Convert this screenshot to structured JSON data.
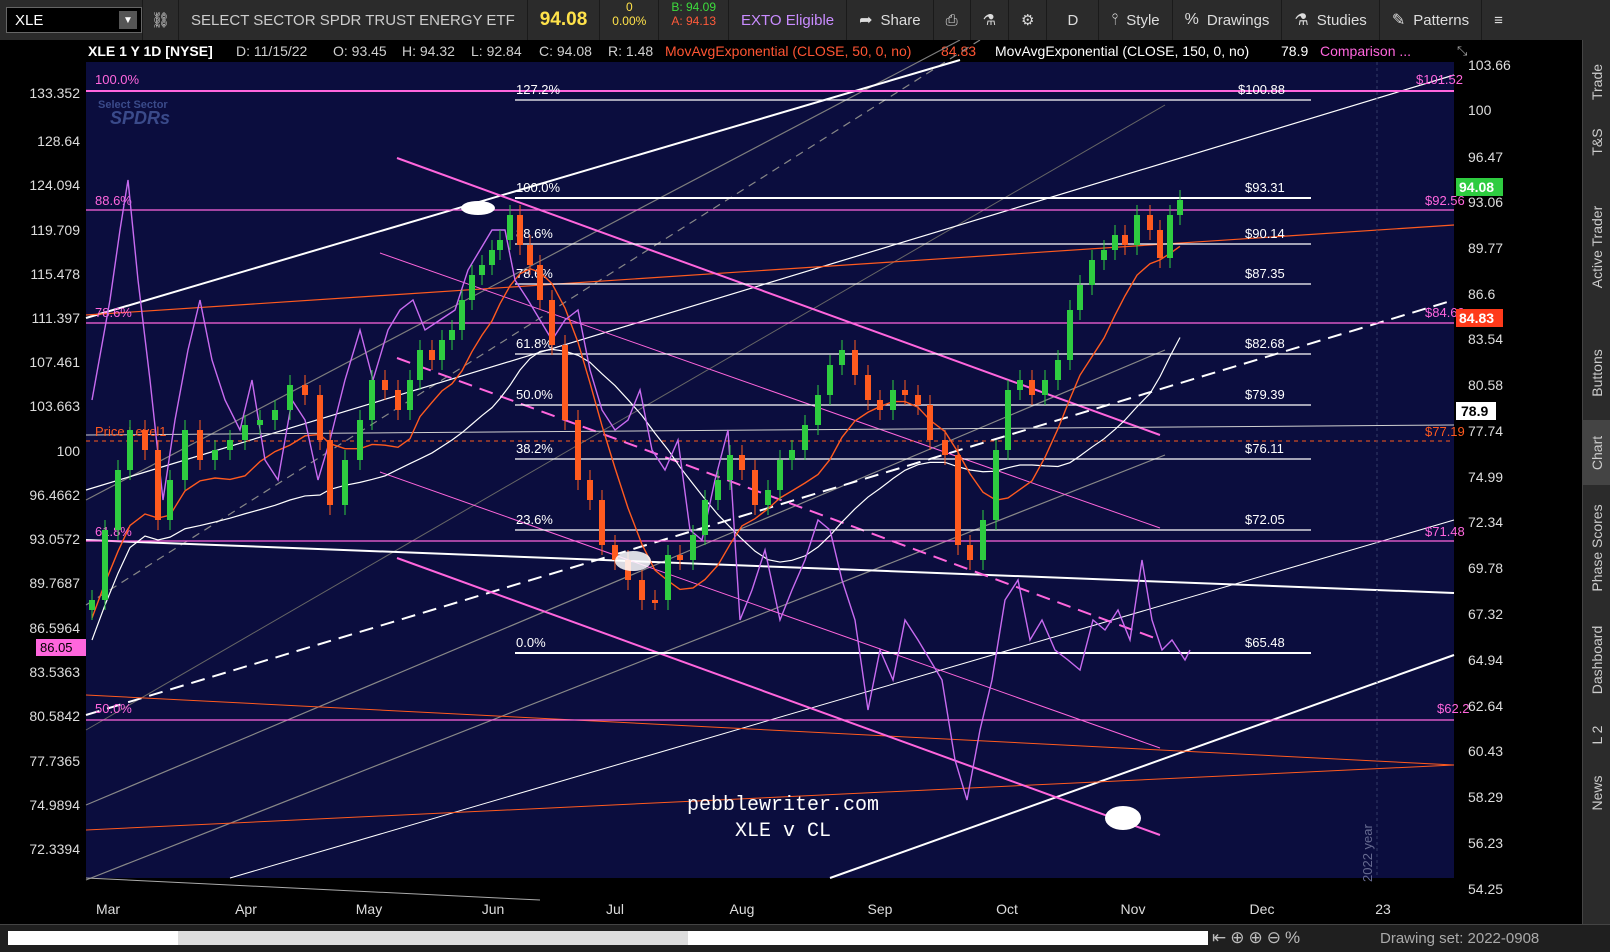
{
  "toolbar": {
    "symbol": "XLE",
    "description": "SELECT SECTOR SPDR TRUST ENERGY ETF",
    "last": "94.08",
    "change": "0",
    "change_pct": "0.00%",
    "bid": "B: 94.09",
    "ask": "A: 94.13",
    "exto": "EXTO Eligible",
    "share": "Share",
    "period": "D",
    "style": "Style",
    "drawings": "Drawings",
    "studies": "Studies",
    "patterns": "Patterns"
  },
  "header": {
    "title": "XLE 1 Y 1D [NYSE]",
    "date": "D: 11/15/22",
    "open": "O: 93.45",
    "high": "H: 94.32",
    "low": "L: 92.84",
    "close": "C: 94.08",
    "range": "R: 1.48",
    "ema50_label": "MovAvgExponential (CLOSE, 50, 0, no)",
    "ema50_value": "84.83",
    "ema150_label": "MovAvgExponential (CLOSE, 150, 0, no)",
    "ema150_value": "78.9",
    "comparison": "Comparison ..."
  },
  "watermark": {
    "line1": "Select Sector",
    "line2": "SPDRs"
  },
  "left_axis": [
    "133.352",
    "128.64",
    "124.094",
    "119.709",
    "115.478",
    "111.397",
    "107.461",
    "103.663",
    "100",
    "96.4662",
    "93.0572",
    "89.7687",
    "86.5964",
    "83.5363",
    "80.5842",
    "77.7365",
    "74.9894",
    "72.3394"
  ],
  "left_axis_flag": "86.05",
  "right_axis": [
    "103.66",
    "100",
    "96.47",
    "93.06",
    "89.77",
    "86.6",
    "83.54",
    "80.58",
    "77.74",
    "74.99",
    "72.34",
    "69.78",
    "67.32",
    "64.94",
    "62.64",
    "60.43",
    "58.29",
    "56.23",
    "54.25"
  ],
  "right_flags": {
    "price": "94.08",
    "ema50": "84.83",
    "ema150": "78.9"
  },
  "x_axis": [
    "Mar",
    "Apr",
    "May",
    "Jun",
    "Jul",
    "Aug",
    "Sep",
    "Oct",
    "Nov",
    "Dec",
    "23"
  ],
  "year_marker": "2022 year",
  "fib_xle": [
    {
      "pct": "127.2%",
      "price": "$100.88"
    },
    {
      "pct": "100.0%",
      "price": "$93.31"
    },
    {
      "pct": "88.6%",
      "price": "$90.14"
    },
    {
      "pct": "78.6%",
      "price": "$87.35"
    },
    {
      "pct": "61.8%",
      "price": "$82.68"
    },
    {
      "pct": "50.0%",
      "price": "$79.39"
    },
    {
      "pct": "38.2%",
      "price": "$76.11"
    },
    {
      "pct": "23.6%",
      "price": "$72.05"
    },
    {
      "pct": "0.0%",
      "price": "$65.48"
    }
  ],
  "fib_cl": [
    {
      "pct": "100.0%",
      "price": "$101.52"
    },
    {
      "pct": "88.6%",
      "price": "$92.56"
    },
    {
      "pct": "78.6%",
      "price": "$84.69"
    },
    {
      "pct": "61.8%",
      "price": "$71.48"
    },
    {
      "pct": "50.0%",
      "price": "$62.2"
    }
  ],
  "price_level_label": "Price Level1",
  "price_level_value": "$77.19",
  "annotation": {
    "line1": "pebblewriter.com",
    "line2": "XLE v CL"
  },
  "right_tabs": [
    "Trade",
    "T&S",
    "Active Trader",
    "Buttons",
    "Chart",
    "Phase Scores",
    "Dashboard",
    "L 2",
    "News"
  ],
  "bottom": {
    "drawing_set": "Drawing set: 2022-0908"
  },
  "colors": {
    "bg": "#0b0d3e",
    "xle_fib": "#ffffff",
    "cl_fib": "#ff66dd",
    "up": "#2ecc40",
    "down": "#ff5a1f",
    "ema": "#ff6a00",
    "cl_line": "#c86bf0"
  }
}
